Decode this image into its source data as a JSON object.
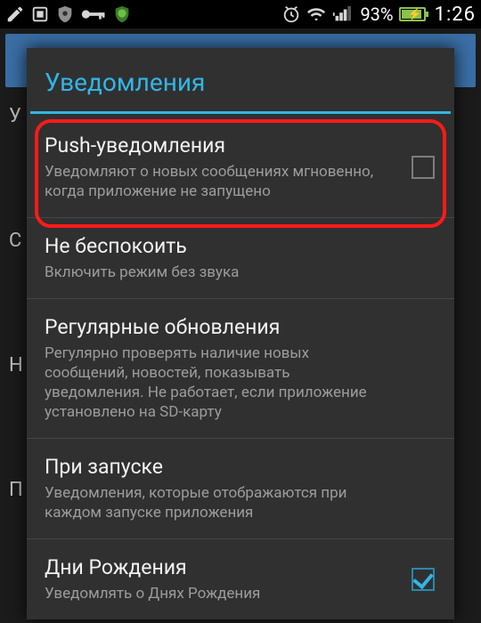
{
  "status": {
    "battery_pct": "93%",
    "clock": "1:26"
  },
  "bg": {
    "lines": [
      "У",
      "",
      "С",
      "",
      "Н",
      "",
      "П",
      ""
    ]
  },
  "dialog": {
    "title": "Уведомления",
    "items": [
      {
        "title": "Push-уведомления",
        "sub": "Уведомляют о новых сообщениях мгновенно, когда приложение не запущено",
        "checkbox": true,
        "checked": false
      },
      {
        "title": "Не беспокоить",
        "sub": "Включить режим без звука",
        "checkbox": false
      },
      {
        "title": "Регулярные обновления",
        "sub": "Регулярно проверять наличие новых сообщений, новостей, показывать уведомления. Не работает, если приложение установлено на SD-карту",
        "checkbox": false
      },
      {
        "title": "При запуске",
        "sub": "Уведомления, которые отображаются при каждом запуске приложения",
        "checkbox": false
      },
      {
        "title": "Дни Рождения",
        "sub": "Уведомлять о Днях Рождения",
        "checkbox": true,
        "checked": true
      }
    ]
  }
}
